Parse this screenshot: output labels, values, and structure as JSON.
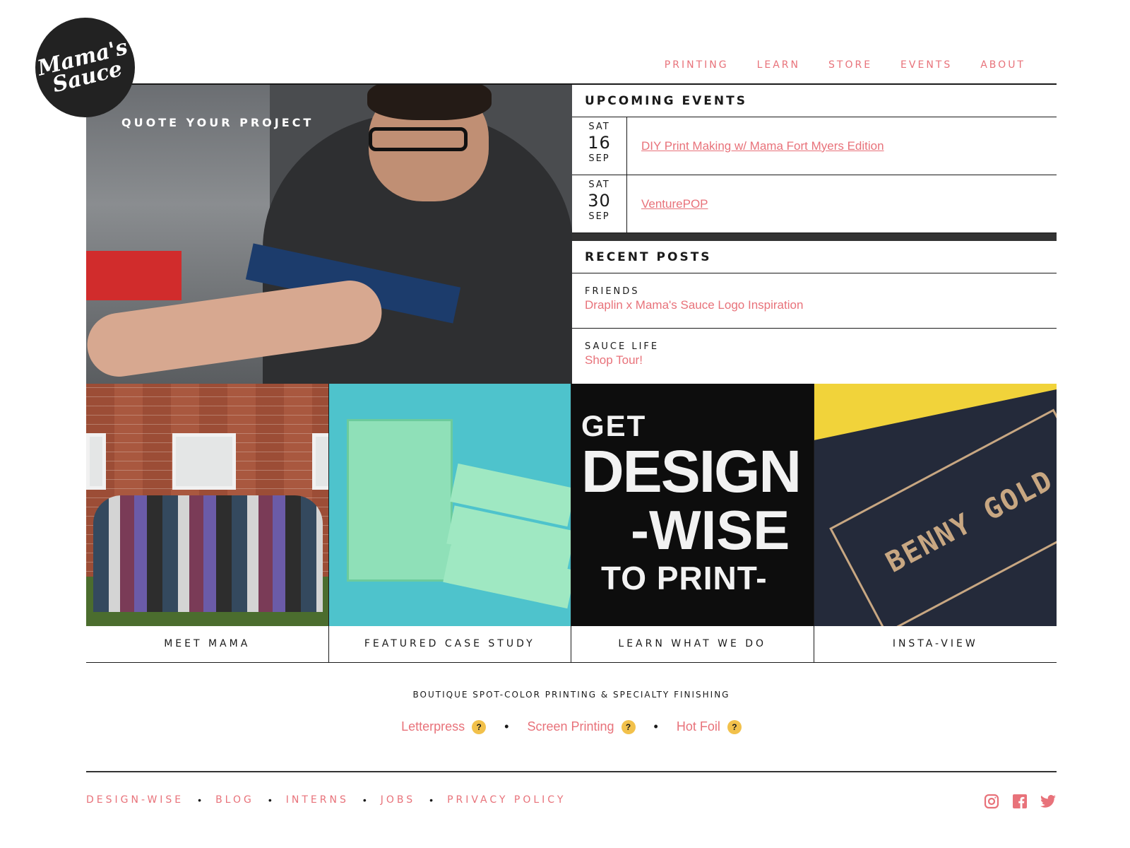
{
  "logo": {
    "text": "Mama's Sauce"
  },
  "nav": [
    "PRINTING",
    "LEARN",
    "STORE",
    "EVENTS",
    "ABOUT"
  ],
  "hero": {
    "label": "QUOTE YOUR PROJECT"
  },
  "events": {
    "title": "UPCOMING EVENTS",
    "items": [
      {
        "dow": "SAT",
        "day": "16",
        "mon": "SEP",
        "title": "DIY Print Making w/ Mama Fort Myers Edition"
      },
      {
        "dow": "SAT",
        "day": "30",
        "mon": "SEP",
        "title": "VenturePOP"
      }
    ]
  },
  "posts": {
    "title": "RECENT POSTS",
    "items": [
      {
        "category": "FRIENDS",
        "title": "Draplin x Mama's Sauce Logo Inspiration"
      },
      {
        "category": "SAUCE LIFE",
        "title": "Shop Tour!"
      }
    ]
  },
  "tiles": {
    "meet": "MEET MAMA",
    "case": "FEATURED CASE STUDY",
    "learn": "LEARN WHAT WE DO",
    "insta": "INSTA-VIEW",
    "design_wise": {
      "get": "GET",
      "design": "DESIGN",
      "wise": "-WISE",
      "print": "TO PRINT-"
    },
    "insta_label": "BENNY GOLD"
  },
  "tagline": "BOUTIQUE SPOT-COLOR PRINTING & SPECIALTY FINISHING",
  "services": [
    "Letterpress",
    "Screen Printing",
    "Hot Foil"
  ],
  "help_glyph": "?",
  "separator": "•",
  "footer": [
    "DESIGN-WISE",
    "BLOG",
    "INTERNS",
    "JOBS",
    "PRIVACY POLICY"
  ],
  "social": [
    "instagram-icon",
    "facebook-icon",
    "twitter-icon"
  ],
  "colors": {
    "accent": "#e8727a",
    "dark": "#222222",
    "help_badge": "#f2c14b"
  }
}
